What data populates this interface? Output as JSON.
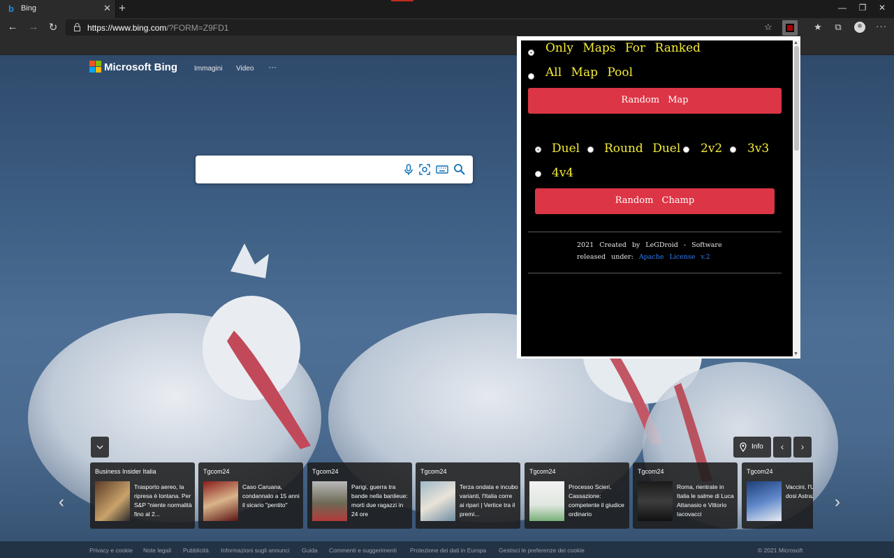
{
  "browser": {
    "tab_title": "Bing",
    "new_tab_glyph": "+",
    "close_tab_glyph": "✕",
    "url_main": "https://www.bing.com",
    "url_tail": "/?FORM=Z9FD1",
    "window_controls": [
      "—",
      "❐",
      "✕"
    ]
  },
  "bing": {
    "brand": "Microsoft Bing",
    "nav": [
      "Immagini",
      "Video",
      "···"
    ],
    "search_placeholder": "",
    "news": [
      {
        "source": "Business Insider Italia",
        "headline": "Trasporto aereo, la ripresa è lontana. Per S&P \"niente normalità fino al 2..."
      },
      {
        "source": "Tgcom24",
        "headline": "Caso Caruana, condannato a 15 anni il sicario \"pentito\""
      },
      {
        "source": "Tgcom24",
        "headline": "Parigi, guerra tra bande nella banlieue: morti due ragazzi in 24 ore"
      },
      {
        "source": "Tgcom24",
        "headline": "Terza ondata e incubo varianti, l'Italia corre ai ripari | Vertice tra il premi..."
      },
      {
        "source": "Tgcom24",
        "headline": "Processo Scieri, Cassazione: competente il giudice ordinario"
      },
      {
        "source": "Tgcom24",
        "headline": "Roma, rientrate in Italia le salme di Luca Attanasio e Vittorio Iacovacci"
      },
      {
        "source": "Tgcom24",
        "headline": "Vaccini, l'U nuovo tag dosi Astraz"
      }
    ],
    "info_label": "Info",
    "footer_links": [
      "Privacy e cookie",
      "Note legali",
      "Pubblicità",
      "Informazioni sugli annunci",
      "Guida",
      "Commenti e suggerimenti",
      "Protezione dei dati in Europa",
      "Gestisci le preferenze dei cookie"
    ],
    "copyright": "© 2021 Microsoft"
  },
  "popup": {
    "map_options": [
      {
        "label": "Only Maps For Ranked",
        "checked": true
      },
      {
        "label": "All Map Pool",
        "checked": false
      }
    ],
    "random_map_label": "Random Map",
    "mode_options": [
      {
        "label": "Duel",
        "checked": true
      },
      {
        "label": "Round Duel",
        "checked": false
      },
      {
        "label": "2v2",
        "checked": false
      },
      {
        "label": "3v3",
        "checked": false
      },
      {
        "label": "4v4",
        "checked": false
      }
    ],
    "random_champ_label": "Random Champ",
    "credit_line1": "2021 Created by LeGDroid - Software",
    "credit_line2_prefix": "released under:",
    "license_link": "Apache License v.2"
  },
  "colors": {
    "accent_red": "#dc3545",
    "option_yellow": "#f4ec37",
    "link_blue": "#2f7cf6"
  }
}
